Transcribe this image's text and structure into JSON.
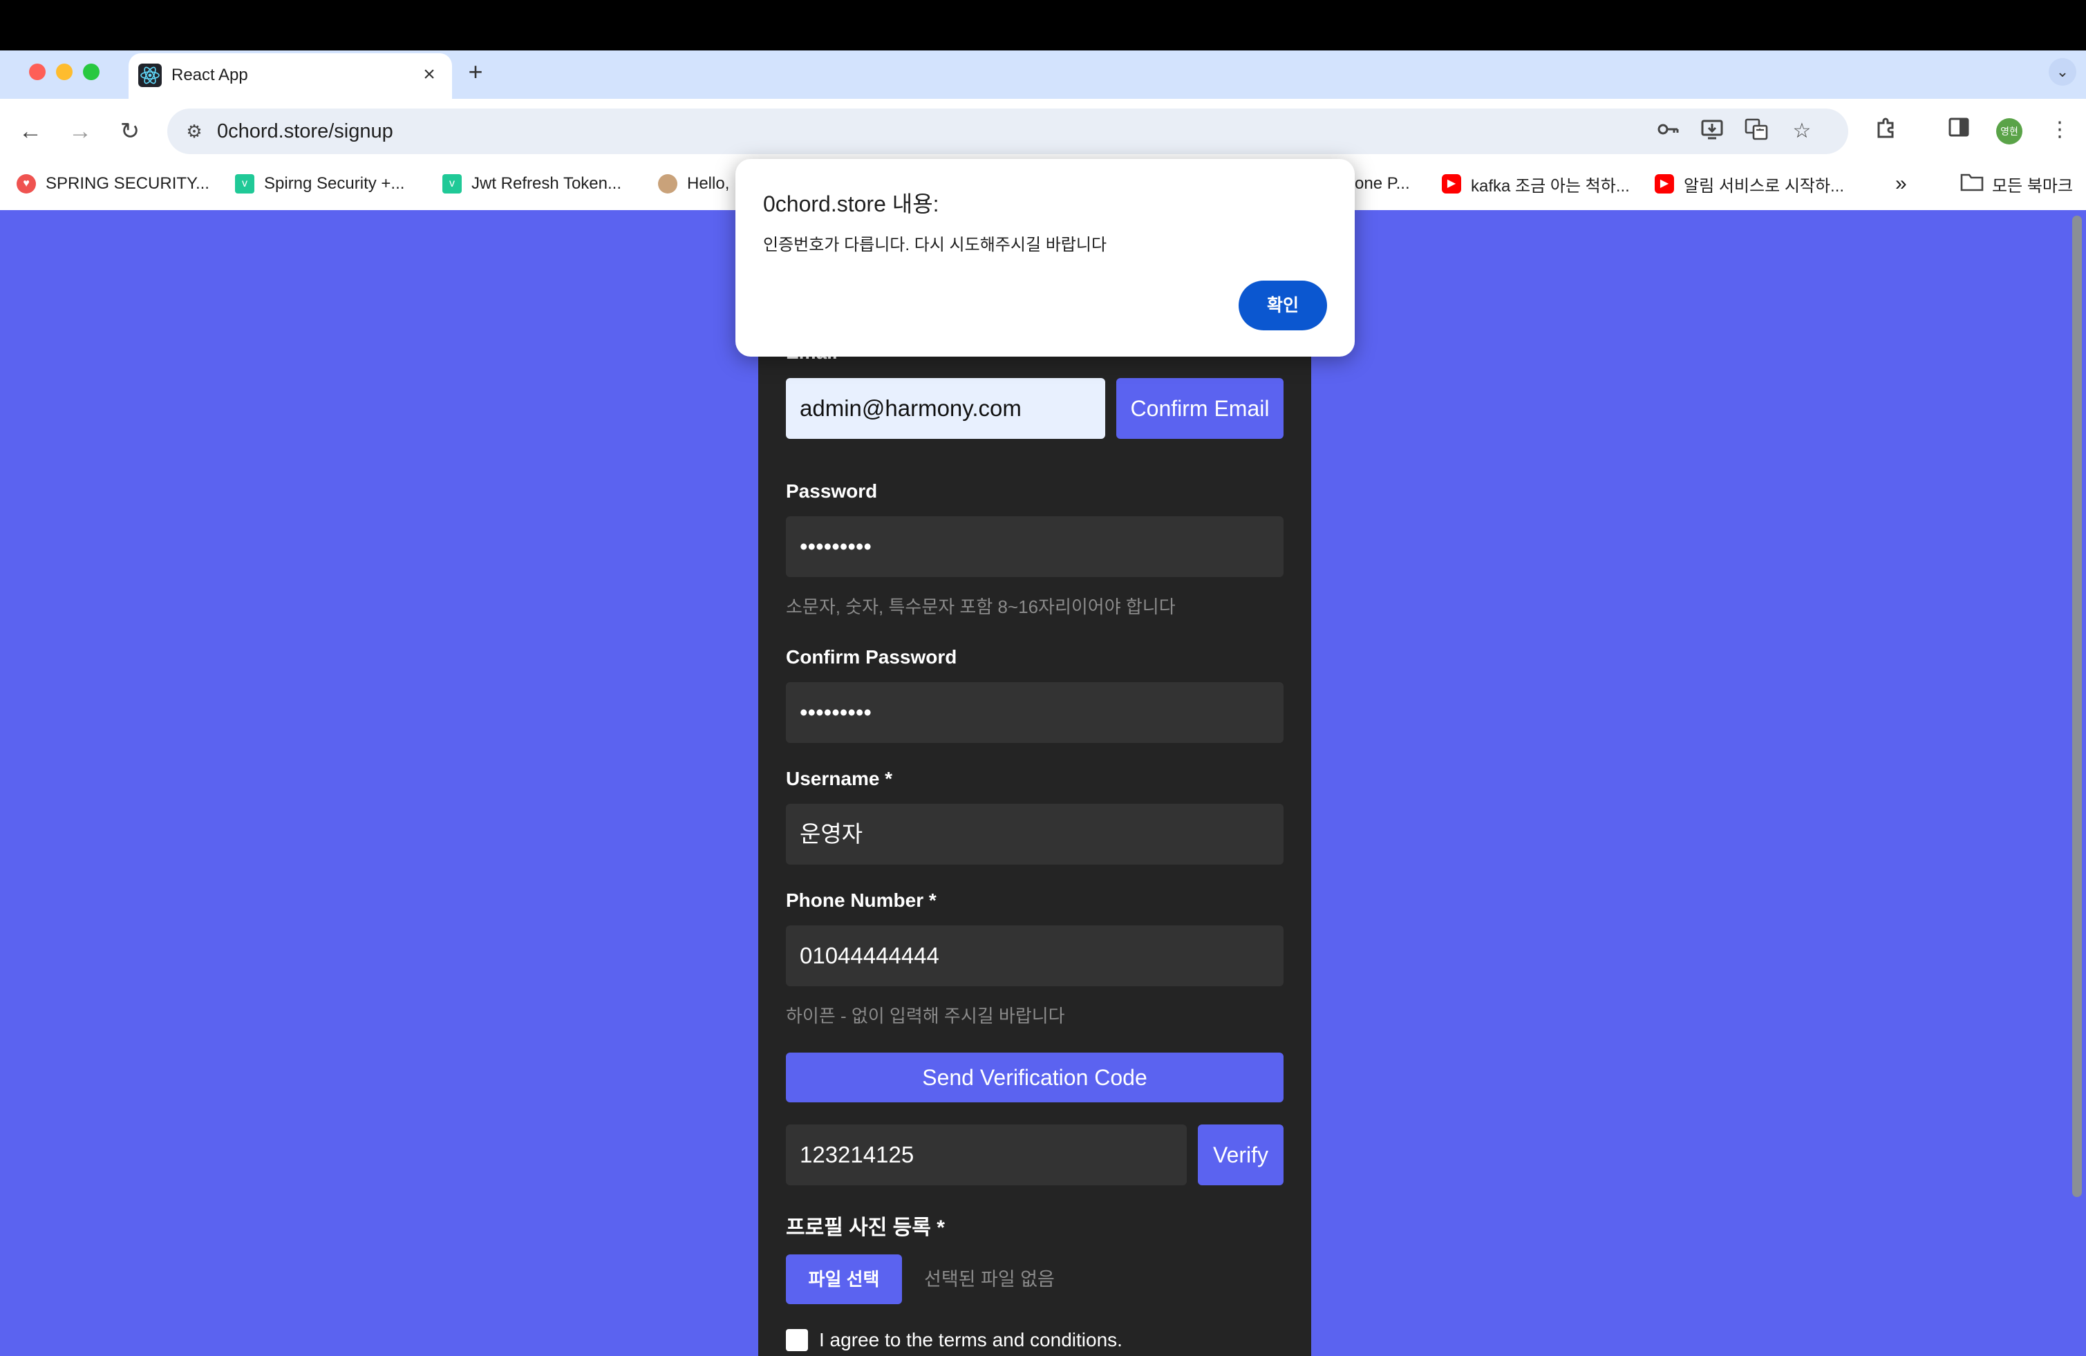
{
  "browser": {
    "tab_title": "React App",
    "url": "0chord.store/signup",
    "profile_initials": "영현",
    "bookmarks": [
      "SPRING SECURITY...",
      "Spirng Security +...",
      "Jwt Refresh Token...",
      "Hello,",
      "one P...",
      "kafka 조금 아는 척하...",
      "알림 서비스로 시작하..."
    ],
    "overflow": "»",
    "all_bookmarks": "모든 북마크"
  },
  "dialog": {
    "title": "0chord.store 내용:",
    "message": "인증번호가 다릅니다. 다시 시도해주시길 바랍니다",
    "ok_label": "확인"
  },
  "form": {
    "email_label": "Email",
    "email_value": "admin@harmony.com",
    "confirm_email_label": "Confirm Email",
    "password_label": "Password",
    "password_value": "•••••••••",
    "password_hint": "소문자, 숫자, 특수문자 포함 8~16자리이어야 합니다",
    "confirm_password_label": "Confirm Password",
    "confirm_password_value": "•••••••••",
    "username_label": "Username *",
    "username_value": "운영자",
    "phone_label": "Phone Number *",
    "phone_value": "01044444444",
    "phone_hint": "하이픈 - 없이 입력해 주시길 바랍니다",
    "send_code_label": "Send Verification Code",
    "code_value": "123214125",
    "verify_label": "Verify",
    "profile_label": "프로필 사진 등록 *",
    "file_button_label": "파일 선택",
    "file_status": "선택된 파일 없음",
    "terms_label": "I agree to the terms and conditions."
  },
  "colors": {
    "page_background": "#5b63f0",
    "card_background": "#242424",
    "accent": "#5b63f0",
    "dialog_button": "#0b57d0"
  }
}
